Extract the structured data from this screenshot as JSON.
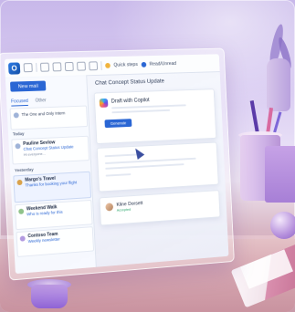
{
  "app": {
    "icon_letter": "O",
    "toolbar": {
      "quick_steps": "Quick steps",
      "read_unread": "Read/Unread"
    }
  },
  "sidebar": {
    "new_mail": "New mail",
    "tabs": [
      "Focused",
      "Other"
    ],
    "sections": [
      "Today",
      "Yesterday"
    ],
    "emails": [
      {
        "from": "",
        "subject": "The One and Only Intern",
        "snippet": ""
      },
      {
        "from": "Pauline Sevlow",
        "subject": "Chat Concept Status Update",
        "snippet": "Hi everyone..."
      },
      {
        "from": "Margo's Travel",
        "subject": "Thanks for booking your flight",
        "snippet": ""
      },
      {
        "from": "Weekend Walk",
        "subject": "Who is ready for this",
        "snippet": ""
      },
      {
        "from": "Contoso Team",
        "subject": "Weekly newsletter",
        "snippet": ""
      }
    ]
  },
  "reading_pane": {
    "title": "Chat Concept Status Update",
    "copilot": {
      "header": "Draft with Copilot",
      "button": "Generate"
    },
    "reply": {
      "name": "Kline Dorsett",
      "status": "Accepted"
    }
  }
}
